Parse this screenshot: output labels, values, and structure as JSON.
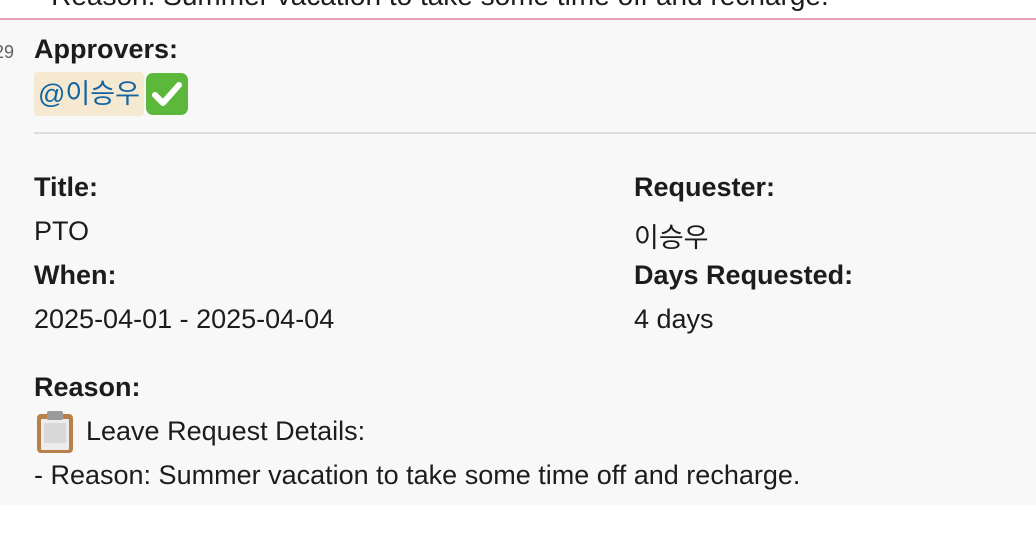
{
  "clipped_text": "- Reason: Summer vacation to take some time off and recharge.",
  "message": {
    "timestamp": "29",
    "approvers_label": "Approvers:",
    "approver_mention": "@이승우",
    "approval_icon": "check-mark-button-icon"
  },
  "fields": {
    "title_label": "Title:",
    "title_value": "PTO",
    "requester_label": "Requester:",
    "requester_value": "이승우",
    "when_label": "When:",
    "when_value": "2025-04-01 - 2025-04-04",
    "days_label": "Days Requested:",
    "days_value": "4 days",
    "reason_label": "Reason:",
    "reason_icon": "clipboard-icon",
    "reason_heading": "Leave Request Details:",
    "reason_line": "- Reason: Summer vacation to take some time off and recharge."
  }
}
